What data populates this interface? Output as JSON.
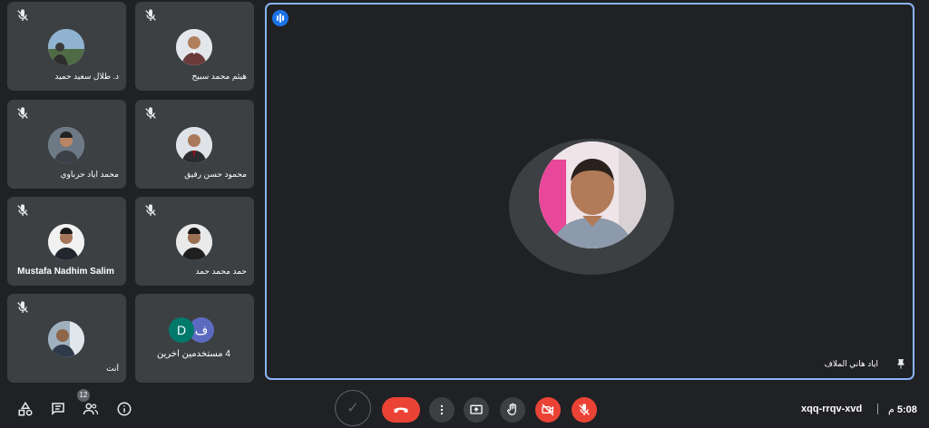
{
  "participants": [
    {
      "name": "هيثم محمد سبيح",
      "muted": true
    },
    {
      "name": "د. طلال سعيد حميد",
      "muted": true
    },
    {
      "name": "محمود حسن رفيق",
      "muted": true
    },
    {
      "name": "محمد اياد حرباوي",
      "muted": true
    },
    {
      "name": "حمد محمد حمد",
      "muted": true
    },
    {
      "name": "Mustafa Nadhim Salim",
      "muted": true
    },
    {
      "name": "أنت",
      "muted": true
    }
  ],
  "others_tile": {
    "label": "4 مستخدمين آخرين",
    "letters": [
      "ف",
      "D"
    ]
  },
  "main_speaker": {
    "name": "اياد هاني الملاف"
  },
  "toolbar": {
    "people_count": "12",
    "meeting_code": "xqq-rrqv-xvd",
    "time": "5:08",
    "time_suffix": "م"
  },
  "colors": {
    "background": "#202124",
    "tile": "#3c4043",
    "accent": "#8ab4f8",
    "danger": "#ea4335",
    "speaking": "#1a73e8"
  },
  "icons": [
    "activities-icon",
    "chat-icon",
    "people-icon",
    "info-icon",
    "more-icon",
    "present-icon",
    "raise-hand-icon",
    "camera-off-icon",
    "mic-off-icon",
    "hangup-icon",
    "pin-icon",
    "speaking-icon"
  ]
}
